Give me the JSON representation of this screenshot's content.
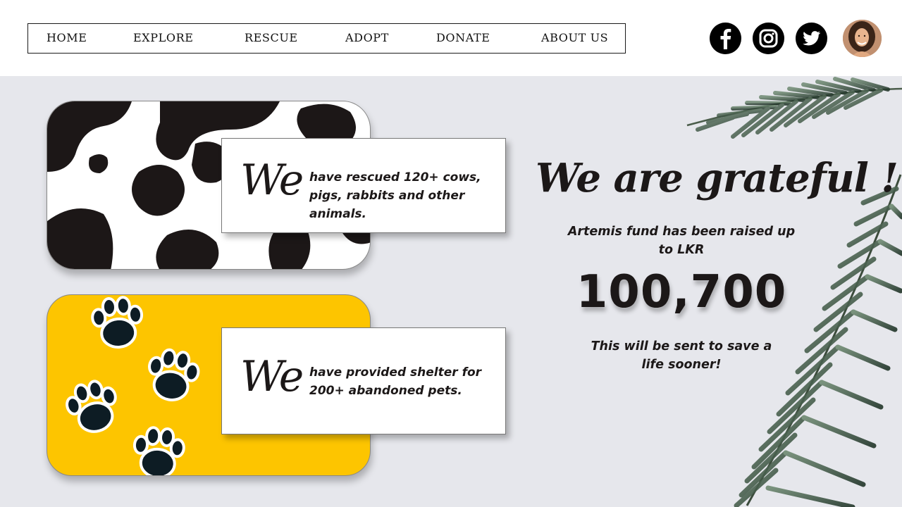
{
  "nav": {
    "items": [
      {
        "label": "HOME"
      },
      {
        "label": "EXPLORE"
      },
      {
        "label": "RESCUE"
      },
      {
        "label": "ADOPT"
      },
      {
        "label": "DONATE"
      },
      {
        "label": "ABOUT US"
      }
    ]
  },
  "social": {
    "icons": [
      "facebook-icon",
      "instagram-icon",
      "twitter-icon"
    ],
    "avatar": "user-avatar"
  },
  "cards": [
    {
      "we": "We",
      "text": "have rescued 120+ cows, pigs, rabbits and other animals."
    },
    {
      "we": "We",
      "text": "have provided shelter for 200+ abandoned pets."
    }
  ],
  "fund": {
    "heading": "We are grateful !",
    "raised_text": "Artemis fund has been raised up to LKR",
    "amount": "100,700",
    "note": "This will be sent to save a life sooner!"
  },
  "colors": {
    "background": "#e6e7ec",
    "accent_yellow": "#fdc500",
    "text": "#1c1818"
  }
}
